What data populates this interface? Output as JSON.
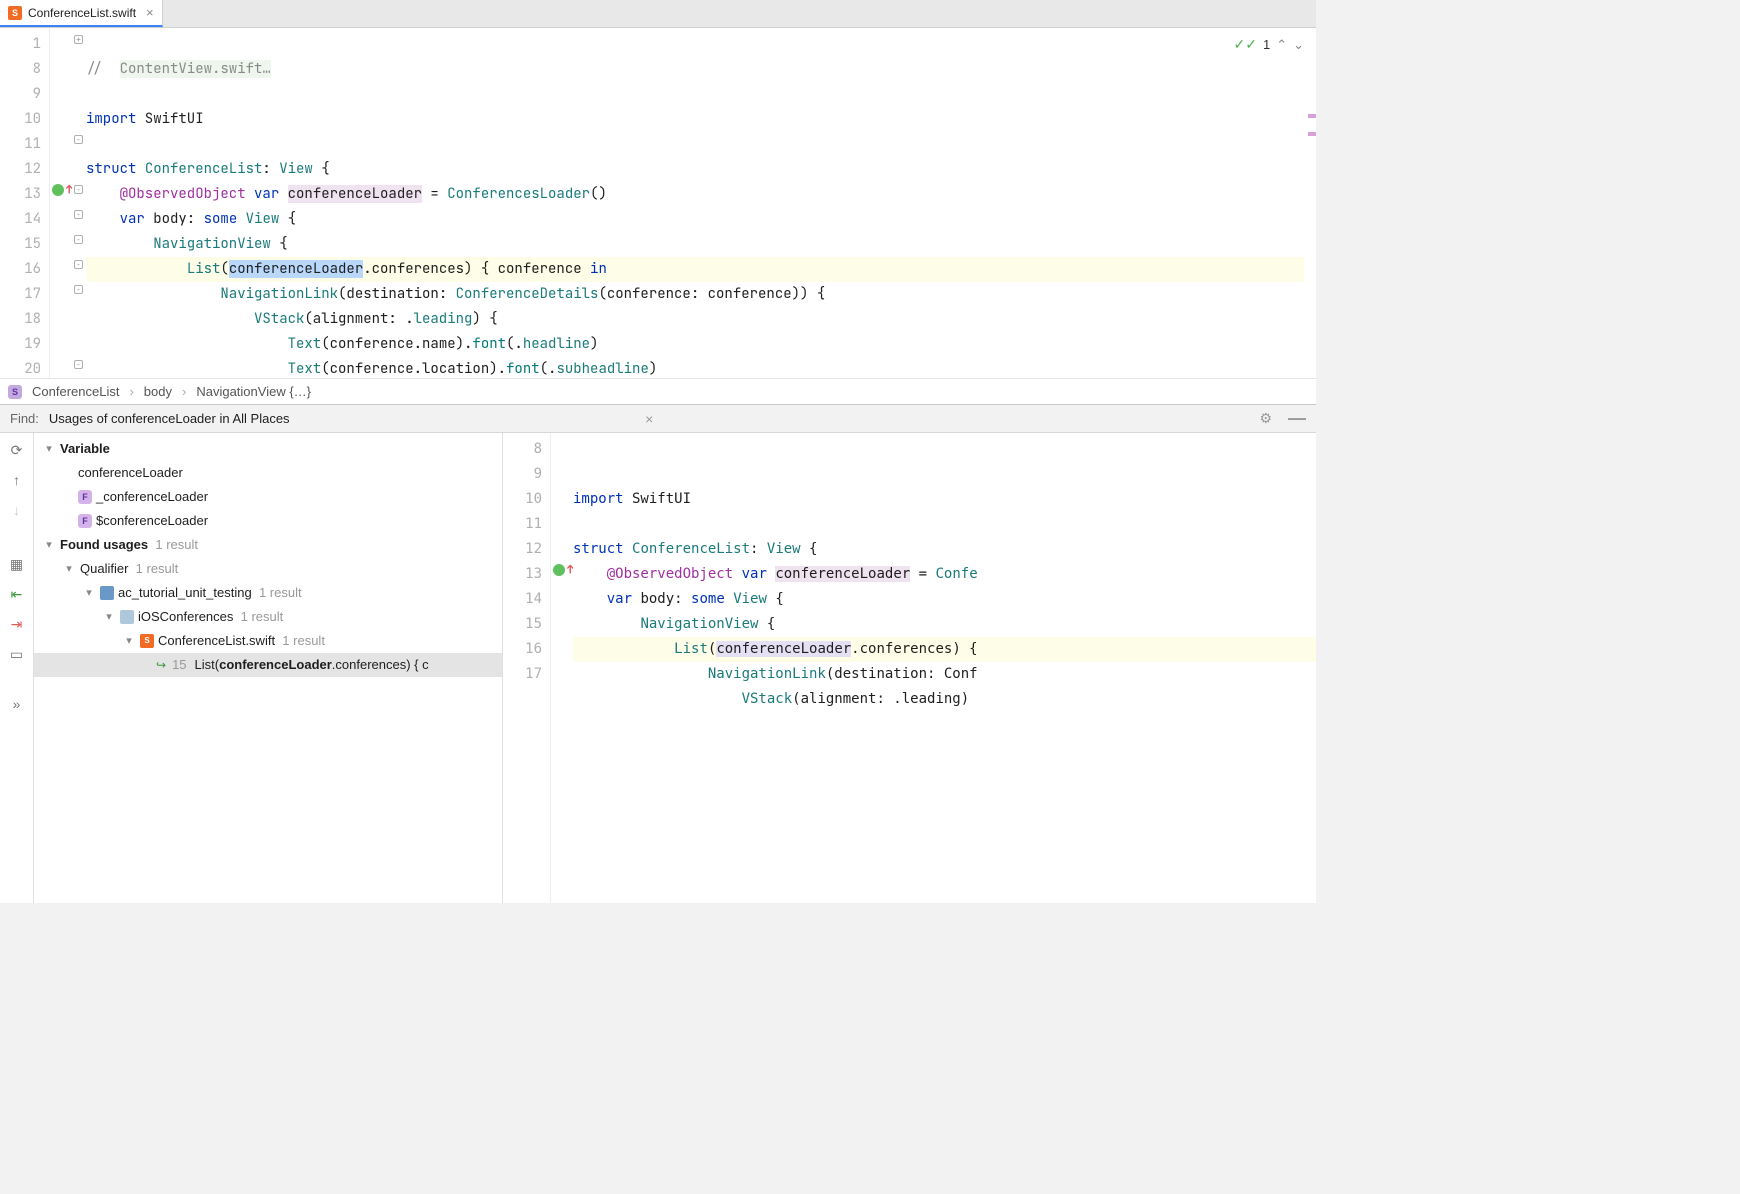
{
  "tab": {
    "filename": "ConferenceList.swift",
    "icon_label": "S"
  },
  "inspect": {
    "count": "1"
  },
  "editor": {
    "lines": [
      "1",
      "8",
      "9",
      "10",
      "11",
      "12",
      "13",
      "14",
      "15",
      "16",
      "17",
      "18",
      "19",
      "20"
    ],
    "l1_a": "//  ",
    "l1_b": "ContentView.swift…",
    "l9_a": "import",
    "l9_b": " SwiftUI",
    "l11_a": "struct",
    "l11_b": " ",
    "l11_c": "ConferenceList",
    "l11_d": ": ",
    "l11_e": "View",
    "l11_f": " {",
    "l12_a": "    ",
    "l12_b": "@ObservedObject",
    "l12_c": " ",
    "l12_d": "var",
    "l12_e": " ",
    "l12_f": "conferenceLoader",
    "l12_g": " = ",
    "l12_h": "ConferencesLoader",
    "l12_i": "()",
    "l13_a": "    ",
    "l13_b": "var",
    "l13_c": " body: ",
    "l13_d": "some",
    "l13_e": " ",
    "l13_f": "View",
    "l13_g": " {",
    "l14_a": "        ",
    "l14_b": "NavigationView",
    "l14_c": " {",
    "l15_a": "            ",
    "l15_b": "List",
    "l15_c": "(",
    "l15_d": "conferenceLoader",
    "l15_e": ".conferences) { conference ",
    "l15_f": "in",
    "l16_a": "                ",
    "l16_b": "NavigationLink",
    "l16_c": "(destination: ",
    "l16_d": "ConferenceDetails",
    "l16_e": "(conference: conference)) {",
    "l17_a": "                    ",
    "l17_b": "VStack",
    "l17_c": "(alignment: .",
    "l17_d": "leading",
    "l17_e": ") {",
    "l18_a": "                        ",
    "l18_b": "Text",
    "l18_c": "(conference.name).",
    "l18_d": "font",
    "l18_e": "(.",
    "l18_f": "headline",
    "l18_g": ")",
    "l19_a": "                        ",
    "l19_b": "Text",
    "l19_c": "(conference.location).",
    "l19_d": "font",
    "l19_e": "(.",
    "l19_f": "subheadline",
    "l19_g": ")",
    "l20_a": "                    }"
  },
  "breadcrumbs": {
    "icon": "S",
    "c1": "ConferenceList",
    "c2": "body",
    "c3": "NavigationView {…}",
    "sep": "›"
  },
  "find": {
    "label": "Find:",
    "title": "Usages of conferenceLoader in All Places",
    "tree": {
      "variable_hdr": "Variable",
      "var_name": "conferenceLoader",
      "var_under": "_conferenceLoader",
      "var_dollar": "$conferenceLoader",
      "found_hdr": "Found usages",
      "found_cnt": "1 result",
      "qualifier": "Qualifier",
      "qualifier_cnt": "1 result",
      "proj": "ac_tutorial_unit_testing",
      "proj_cnt": "1 result",
      "module": "iOSConferences",
      "module_cnt": "1 result",
      "file": "ConferenceList.swift",
      "file_cnt": "1 result",
      "hit_ln": "15",
      "hit_a": "List(",
      "hit_b": "conferenceLoader",
      "hit_c": ".conferences) { c"
    }
  },
  "preview": {
    "lines": [
      "8",
      "9",
      "10",
      "11",
      "12",
      "13",
      "14",
      "15",
      "16",
      "17"
    ],
    "l9_a": "import",
    "l9_b": " SwiftUI",
    "l11_a": "struct",
    "l11_b": " ",
    "l11_c": "ConferenceList",
    "l11_d": ": ",
    "l11_e": "View",
    "l11_f": " {",
    "l12_a": "    ",
    "l12_b": "@ObservedObject",
    "l12_c": " ",
    "l12_d": "var",
    "l12_e": " ",
    "l12_f": "conferenceLoader",
    "l12_g": " = ",
    "l12_h": "Confe",
    "l13_a": "    ",
    "l13_b": "var",
    "l13_c": " body: ",
    "l13_d": "some",
    "l13_e": " ",
    "l13_f": "View",
    "l13_g": " {",
    "l14_a": "        ",
    "l14_b": "NavigationView",
    "l14_c": " {",
    "l15_a": "            ",
    "l15_b": "List",
    "l15_c": "(",
    "l15_d": "conferenceLoader",
    "l15_e": ".conferences) {",
    "l16_a": "                ",
    "l16_b": "NavigationLink",
    "l16_c": "(destination: Conf",
    "l17_a": "                    ",
    "l17_b": "VStack",
    "l17_c": "(alignment: .leading)"
  }
}
